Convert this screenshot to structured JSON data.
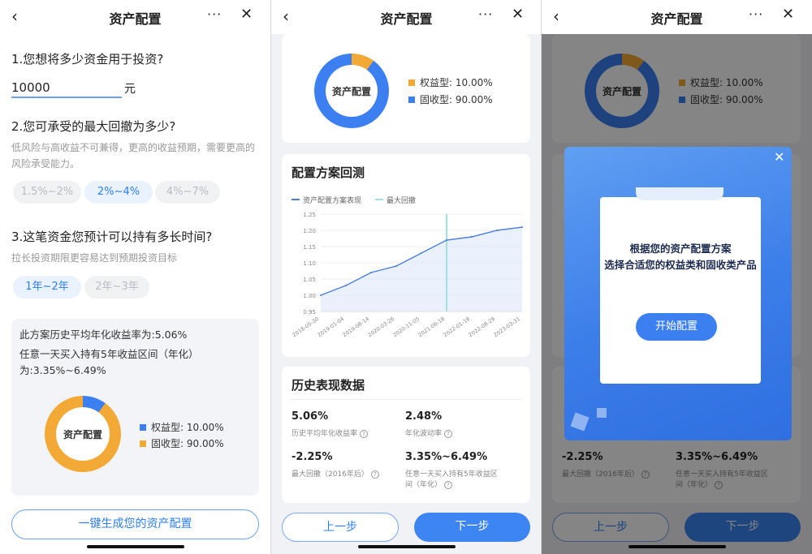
{
  "nav": {
    "back": "‹",
    "title": "资产配置",
    "more": "···",
    "close": "✕"
  },
  "screen1": {
    "q1": "1.您想将多少资金用于投资?",
    "amount": "10000",
    "unit": "元",
    "q2": "2.您可承受的最大回撤为多少?",
    "q2_hint": "低风险与高收益不可兼得，更高的收益预期，需要更高的风险承受能力。",
    "drawdown_options": [
      "1.5%~2%",
      "2%~4%",
      "4%~7%"
    ],
    "drawdown_selected": "2%~4%",
    "q3": "3.这笔资金您预计可以持有多长时间?",
    "q3_hint": "拉长投资期限更容易达到预期投资目标",
    "duration_options": [
      "1年~2年",
      "2年~3年"
    ],
    "duration_selected": "1年~2年",
    "summary1": "此方案历史平均年化收益率为:5.06%",
    "summary2": "任意一天买入持有5年收益区间（年化）为:3.35%~6.49%",
    "donut_label": "资产配置",
    "legend": [
      {
        "label": "权益型:",
        "value": "10.00%",
        "color": "#3b7ff0"
      },
      {
        "label": "固收型:",
        "value": "90.00%",
        "color": "#f3a935"
      }
    ],
    "generate_button": "一键生成您的资产配置"
  },
  "screen2": {
    "donut_label": "资产配置",
    "legend": [
      {
        "label": "权益型:",
        "value": "10.00%",
        "color": "#f3a935"
      },
      {
        "label": "固收型:",
        "value": "90.00%",
        "color": "#3b7ff0"
      }
    ],
    "backtest_title": "配置方案回测",
    "backtest_legend": [
      "资产配置方案表现",
      "最大回撤"
    ],
    "history_title": "历史表现数据",
    "stats": [
      {
        "value": "5.06%",
        "label": "历史平均年化收益率"
      },
      {
        "value": "2.48%",
        "label": "年化波动率"
      },
      {
        "value": "-2.25%",
        "label": "最大回撤（2016年后）"
      },
      {
        "value": "3.35%~6.49%",
        "label": "任意一天买入持有5年收益区间（年化）"
      }
    ],
    "prev_button": "上一步",
    "next_button": "下一步"
  },
  "screen3": {
    "popup_line1": "根据您的资产配置方案",
    "popup_line2": "选择合适您的权益类和固收类产品",
    "start_button": "开始配置",
    "popup_close": "✕"
  },
  "chart_data": {
    "type": "line",
    "title": "配置方案回测",
    "series": [
      {
        "name": "资产配置方案表现",
        "color": "#4a7fd6"
      },
      {
        "name": "最大回撤",
        "color": "#9fe0e0"
      }
    ],
    "x": [
      "2018-05-30",
      "2019-01-04",
      "2019-08-14",
      "2020-03-26",
      "2020-11-05",
      "2021-06-18",
      "2022-01-18",
      "2022-08-29",
      "2023-03-31"
    ],
    "y": [
      1.0,
      1.03,
      1.07,
      1.09,
      1.13,
      1.17,
      1.18,
      1.2,
      1.21
    ],
    "yticks": [
      0.95,
      1.0,
      1.05,
      1.1,
      1.15,
      1.2,
      1.25
    ],
    "ylim": [
      0.95,
      1.25
    ],
    "max_drawdown_marker_x": "2021-06-18",
    "grid": true,
    "legend_position": "top-left"
  }
}
